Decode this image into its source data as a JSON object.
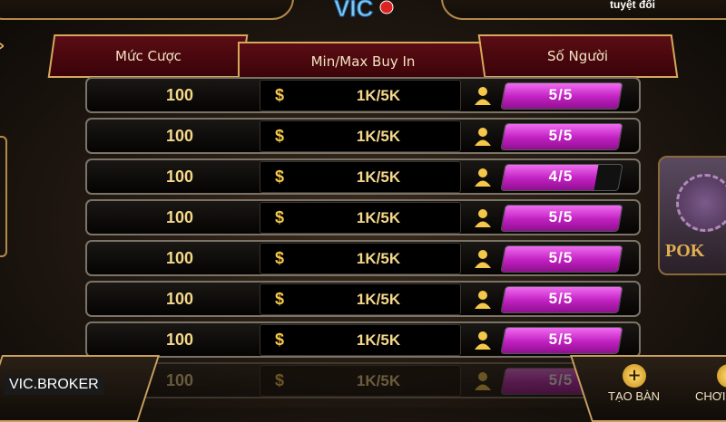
{
  "header": {
    "top_right_text": "tuyệt đối",
    "logo_text": "VIC"
  },
  "columns": {
    "bet": "Mức Cược",
    "buy_in": "Min/Max Buy In",
    "players": "Số Người"
  },
  "rows": [
    {
      "bet": "100",
      "currency": "$",
      "buy_in": "1K/5K",
      "players": "5/5",
      "fill": 1.0
    },
    {
      "bet": "100",
      "currency": "$",
      "buy_in": "1K/5K",
      "players": "5/5",
      "fill": 1.0
    },
    {
      "bet": "100",
      "currency": "$",
      "buy_in": "1K/5K",
      "players": "4/5",
      "fill": 0.8
    },
    {
      "bet": "100",
      "currency": "$",
      "buy_in": "1K/5K",
      "players": "5/5",
      "fill": 1.0
    },
    {
      "bet": "100",
      "currency": "$",
      "buy_in": "1K/5K",
      "players": "5/5",
      "fill": 1.0
    },
    {
      "bet": "100",
      "currency": "$",
      "buy_in": "1K/5K",
      "players": "5/5",
      "fill": 1.0
    },
    {
      "bet": "100",
      "currency": "$",
      "buy_in": "1K/5K",
      "players": "5/5",
      "fill": 1.0
    },
    {
      "bet": "100",
      "currency": "$",
      "buy_in": "1K/5K",
      "players": "5/5",
      "fill": 1.0
    }
  ],
  "side_game": {
    "label": "POK"
  },
  "footer": {
    "broker_label": "VIC.BROKER",
    "create_table": "TẠO BÀN",
    "play_now": "CHƠI"
  },
  "colors": {
    "header_tab": "#5a0d14",
    "accent_gold": "#d7a85c",
    "player_fill": "#c020c0",
    "text_gold": "#f4d78a"
  }
}
